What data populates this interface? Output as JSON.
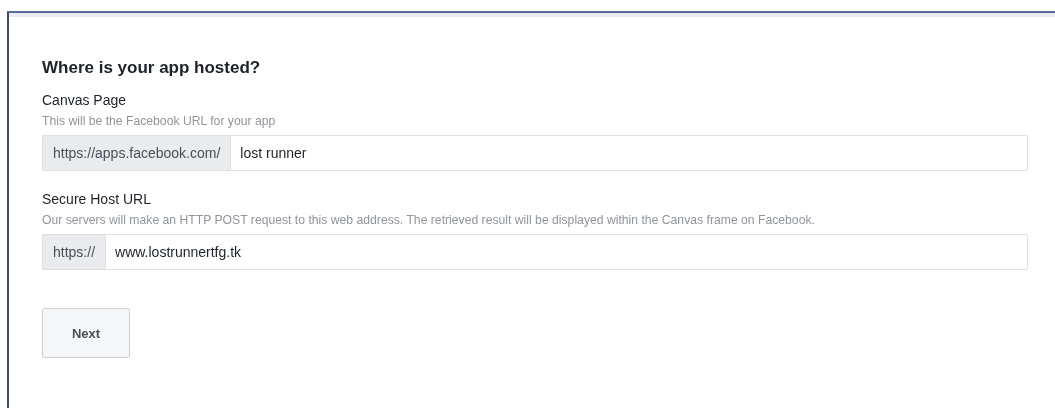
{
  "heading": "Where is your app hosted?",
  "fields": [
    {
      "label": "Canvas Page",
      "hint": "This will be the Facebook URL for your app",
      "prefix": "https://apps.facebook.com/",
      "value": "lost runner"
    },
    {
      "label": "Secure Host URL",
      "hint": "Our servers will make an HTTP POST request to this web address. The retrieved result will be displayed within the Canvas frame on Facebook.",
      "prefix": "https://",
      "value": "www.lostrunnertfg.tk"
    }
  ],
  "buttons": [
    "Next"
  ]
}
